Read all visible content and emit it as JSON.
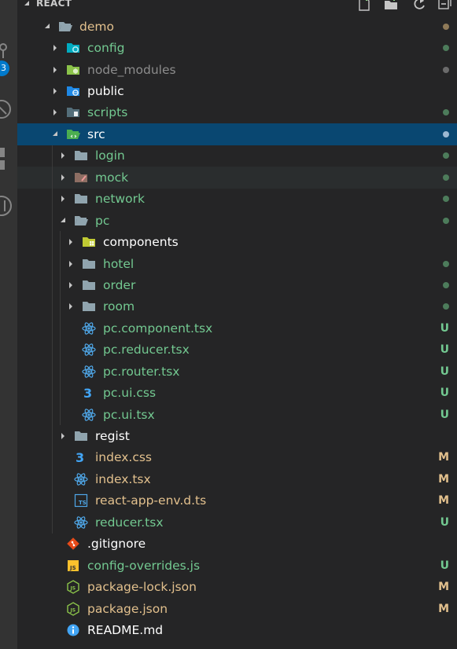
{
  "explorer": {
    "section_title": "REACT"
  },
  "colors": {
    "added": "#73c991",
    "modified": "#e2c08d",
    "default": "#cccccc",
    "ignored": "#8c8c8c",
    "selected_bg": "#094771",
    "badge": "#007acc"
  },
  "activity_badge": "3",
  "tree": [
    {
      "name": "demo",
      "type": "folder",
      "icon": "folder-open-icon",
      "status": "modified"
    },
    {
      "name": "config",
      "type": "folder",
      "icon": "folder-config-icon",
      "status": "added"
    },
    {
      "name": "node_modules",
      "type": "folder",
      "icon": "folder-node-icon",
      "status": "ignored"
    },
    {
      "name": "public",
      "type": "folder",
      "icon": "folder-public-icon",
      "status": "default"
    },
    {
      "name": "scripts",
      "type": "folder",
      "icon": "folder-scripts-icon",
      "status": "added"
    },
    {
      "name": "src",
      "type": "folder",
      "icon": "folder-src-open-icon",
      "status": "selected"
    },
    {
      "name": "login",
      "type": "folder",
      "icon": "folder-icon",
      "status": "added"
    },
    {
      "name": "mock",
      "type": "folder",
      "icon": "folder-mock-icon",
      "status": "added"
    },
    {
      "name": "network",
      "type": "folder",
      "icon": "folder-icon",
      "status": "added"
    },
    {
      "name": "pc",
      "type": "folder",
      "icon": "folder-open-icon",
      "status": "added"
    },
    {
      "name": "components",
      "type": "folder",
      "icon": "folder-components-icon",
      "status": "default"
    },
    {
      "name": "hotel",
      "type": "folder",
      "icon": "folder-icon",
      "status": "added"
    },
    {
      "name": "order",
      "type": "folder",
      "icon": "folder-icon",
      "status": "added"
    },
    {
      "name": "room",
      "type": "folder",
      "icon": "folder-icon",
      "status": "added"
    },
    {
      "name": "pc.component.tsx",
      "type": "file",
      "icon": "react-icon",
      "status": "added",
      "badge": "U"
    },
    {
      "name": "pc.reducer.tsx",
      "type": "file",
      "icon": "react-icon",
      "status": "added",
      "badge": "U"
    },
    {
      "name": "pc.router.tsx",
      "type": "file",
      "icon": "react-icon",
      "status": "added",
      "badge": "U"
    },
    {
      "name": "pc.ui.css",
      "type": "file",
      "icon": "css-icon",
      "status": "added",
      "badge": "U"
    },
    {
      "name": "pc.ui.tsx",
      "type": "file",
      "icon": "react-icon",
      "status": "added",
      "badge": "U"
    },
    {
      "name": "regist",
      "type": "folder",
      "icon": "folder-icon",
      "status": "default"
    },
    {
      "name": "index.css",
      "type": "file",
      "icon": "css-icon",
      "status": "modified",
      "badge": "M"
    },
    {
      "name": "index.tsx",
      "type": "file",
      "icon": "react-icon",
      "status": "modified",
      "badge": "M"
    },
    {
      "name": "react-app-env.d.ts",
      "type": "file",
      "icon": "typescript-icon",
      "status": "modified",
      "badge": "M"
    },
    {
      "name": "reducer.tsx",
      "type": "file",
      "icon": "react-icon",
      "status": "added",
      "badge": "U"
    },
    {
      "name": ".gitignore",
      "type": "file",
      "icon": "git-icon",
      "status": "default"
    },
    {
      "name": "config-overrides.js",
      "type": "file",
      "icon": "javascript-icon",
      "status": "added",
      "badge": "U"
    },
    {
      "name": "package-lock.json",
      "type": "file",
      "icon": "nodejs-icon",
      "status": "modified",
      "badge": "M"
    },
    {
      "name": "package.json",
      "type": "file",
      "icon": "nodejs-icon",
      "status": "modified",
      "badge": "M"
    },
    {
      "name": "README.md",
      "type": "file",
      "icon": "info-icon",
      "status": "default"
    }
  ]
}
